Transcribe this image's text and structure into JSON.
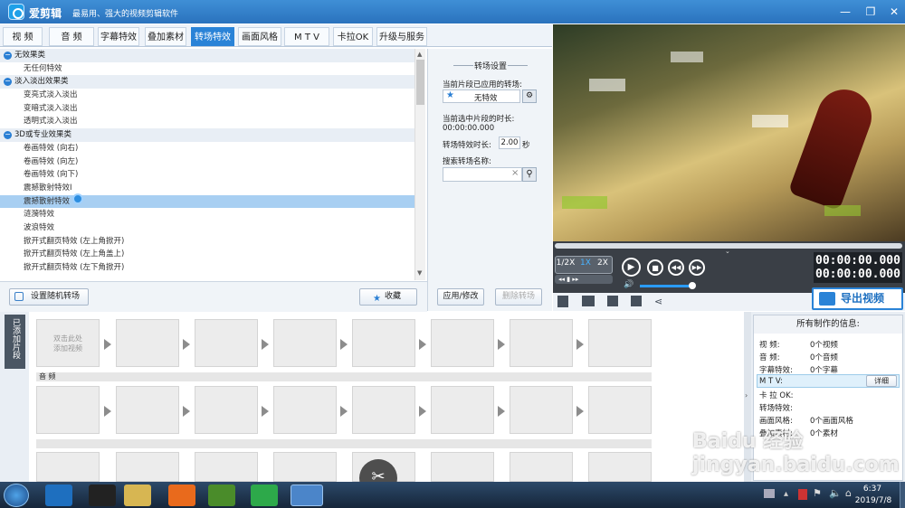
{
  "app": {
    "title": "爱剪辑",
    "slogan": "最易用、强大的视频剪辑软件"
  },
  "tabs": [
    {
      "label": "视  频"
    },
    {
      "label": "音  频"
    },
    {
      "label": "字幕特效"
    },
    {
      "label": "叠加素材"
    },
    {
      "label": "转场特效",
      "active": true
    },
    {
      "label": "画面风格"
    },
    {
      "label": "M T V"
    },
    {
      "label": "卡拉OK"
    },
    {
      "label": "升级与服务"
    }
  ],
  "effect_list": {
    "categories": [
      {
        "label": "无效果类",
        "items": [
          "无任何特效"
        ]
      },
      {
        "label": "淡入淡出效果类",
        "items": [
          "变亮式淡入淡出",
          "变暗式淡入淡出",
          "透明式淡入淡出"
        ]
      },
      {
        "label": "3D或专业效果类",
        "items": [
          "卷画特效 (向右)",
          "卷画特效 (向左)",
          "卷画特效 (向下)",
          "震撼散射特效I",
          "震撼散射特效",
          "涟漪特效",
          "波浪特效",
          "掀开式翻页特效 (左上角掀开)",
          "掀开式翻页特效 (左上角盖上)",
          "掀开式翻页特效 (左下角掀开)"
        ]
      }
    ],
    "selected": "震撼散射特效"
  },
  "buttons": {
    "random": "设置随机转场",
    "favorite": "收藏",
    "apply": "应用/修改",
    "delete": "删除转场",
    "export": "导出视频"
  },
  "settings": {
    "title": "转场设置",
    "applied_label": "当前片段已应用的转场:",
    "applied_value": "无特效",
    "duration_label": "当前选中片段的时长:",
    "duration_value": "00:00:00.000",
    "effect_duration_label": "转场特效时长:",
    "effect_duration_value": "2.00",
    "effect_duration_unit": "秒",
    "search_label": "搜索转场名称:",
    "search_value": ""
  },
  "player": {
    "speeds": [
      "1/2X",
      "1X",
      "2X"
    ],
    "active_speed": "1X",
    "time_current": "00:00:00.000",
    "time_total": "00:00:00.000"
  },
  "tracks": {
    "side_label": "已添加片段",
    "first_clip_text": "双击此处\n添加视频",
    "audio_label": "音  频"
  },
  "info": {
    "title": "所有制作的信息:",
    "rows": [
      {
        "label": "视    频:",
        "value": "0个视频"
      },
      {
        "label": "音    频:",
        "value": "0个音频"
      },
      {
        "label": "字幕特效:",
        "value": "0个字幕"
      },
      {
        "label": "M  T  V:",
        "value": ""
      },
      {
        "label": "卡  拉 OK:",
        "value": ""
      },
      {
        "label": "转场特效:",
        "value": ""
      },
      {
        "label": "画面风格:",
        "value": "0个画面风格"
      },
      {
        "label": "叠加素材:",
        "value": "0个素材"
      }
    ],
    "detail_button": "详细"
  },
  "taskbar": {
    "time": "6:37",
    "date": "2019/7/8"
  },
  "watermark": "Baidu 经验 jingyan.baidu.com"
}
